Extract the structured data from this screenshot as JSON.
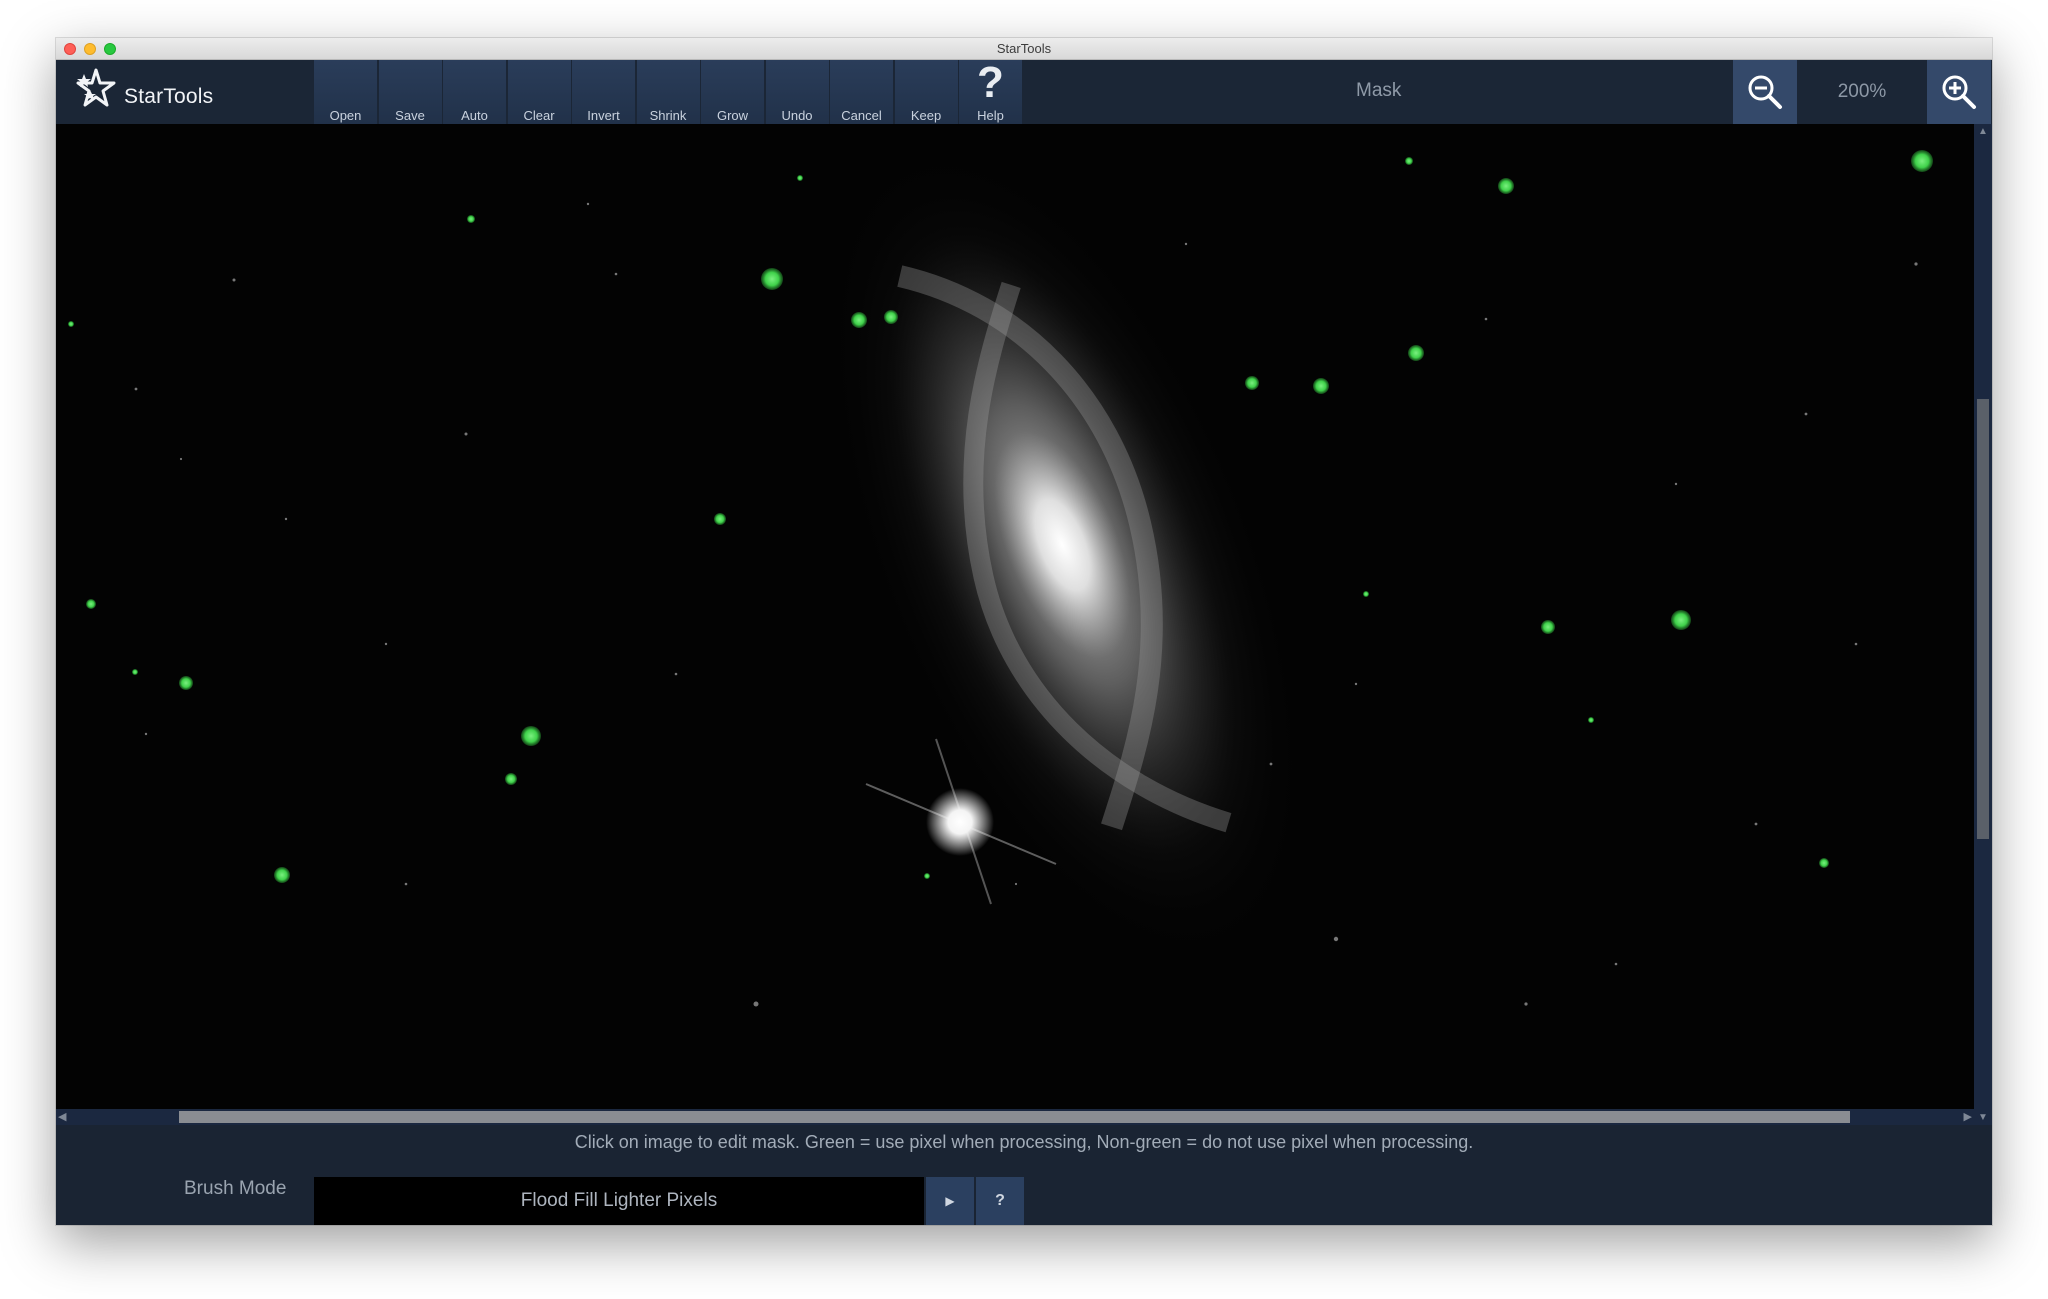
{
  "window": {
    "title": "StarTools"
  },
  "app": {
    "name": "StarTools"
  },
  "toolbar": {
    "buttons": [
      {
        "label": "Open"
      },
      {
        "label": "Save"
      },
      {
        "label": "Auto"
      },
      {
        "label": "Clear"
      },
      {
        "label": "Invert"
      },
      {
        "label": "Shrink"
      },
      {
        "label": "Grow"
      },
      {
        "label": "Undo"
      },
      {
        "label": "Cancel"
      },
      {
        "label": "Keep"
      },
      {
        "label": "Help"
      }
    ],
    "module_title": "Mask",
    "zoom_level": "200%",
    "zoom_out_icon": "zoom-out-icon",
    "zoom_in_icon": "zoom-in-icon"
  },
  "status": {
    "hint": "Click on image to edit mask. Green = use pixel when processing, Non-green = do not use pixel when processing."
  },
  "brush": {
    "label": "Brush Mode",
    "value": "Flood Fill Lighter Pixels",
    "next_icon": "play-icon",
    "help_label": "?"
  },
  "colors": {
    "mask_green": "#3fd14a",
    "toolbar_button": "#213149",
    "zoom_button": "#34496a"
  }
}
